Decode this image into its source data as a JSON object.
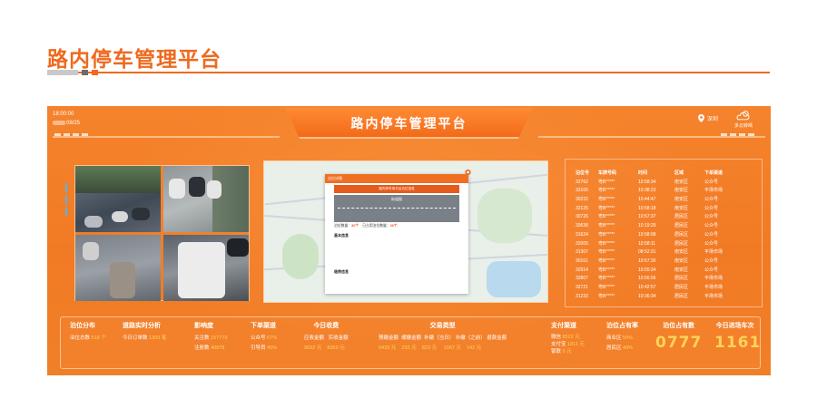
{
  "page": {
    "title": "路内停车管理平台"
  },
  "colors": {
    "accent": "#ef6a1e",
    "highlight": "#ffd35a",
    "panel": "#f5832c"
  },
  "board": {
    "title": "路内停车管理平台",
    "time": "18:00:00",
    "date_suffix": "08/25",
    "location": "深圳",
    "weather": "多云转晴",
    "location_icon": "map-pin-icon",
    "weather_icon": "cloud-sun-icon"
  },
  "map_popup": {
    "title": "泊位详情",
    "subtitle": "路内停车场平台泊位信息",
    "road_label": "街道图",
    "stats": [
      {
        "label": "泊位数量：",
        "value": "30个"
      },
      {
        "label": "已占用泊位数量：",
        "value": "30个"
      }
    ],
    "section_basic": "基本信息",
    "section_pay": "缴费信息",
    "pin_icon": "map-marker-icon"
  },
  "berth_table": {
    "headers": [
      "泊位号",
      "车牌号码",
      "时间",
      "区域",
      "下单渠道"
    ],
    "rows": [
      [
        "32762",
        "粤B*****",
        "10:58:34",
        "南安区",
        "公众号"
      ],
      [
        "33106",
        "粤B*****",
        "10:38:23",
        "南安区",
        "平场市场"
      ],
      [
        "30232",
        "粤B*****",
        "10:44:47",
        "南安区",
        "公众号"
      ],
      [
        "32125",
        "粤B*****",
        "10:58:18",
        "南安区",
        "公众号"
      ],
      [
        "30726",
        "粤B*****",
        "10:57:37",
        "居民区",
        "公众号"
      ],
      [
        "33638",
        "粤B*****",
        "10:19:29",
        "居民区",
        "公众号"
      ],
      [
        "31624",
        "粤B*****",
        "10:58:08",
        "居民区",
        "公众号"
      ],
      [
        "32005",
        "粤B*****",
        "10:58:11",
        "居民区",
        "公众号"
      ],
      [
        "31307",
        "粤B*****",
        "08:52:31",
        "南安区",
        "平场市场"
      ],
      [
        "30101",
        "粤B*****",
        "10:57:30",
        "南安区",
        "公众号"
      ],
      [
        "32914",
        "粤B*****",
        "10:55:34",
        "南安区",
        "公众号"
      ],
      [
        "32807",
        "粤B*****",
        "10:56:56",
        "居民区",
        "平场市场"
      ],
      [
        "32721",
        "粤B*****",
        "10:42:57",
        "居民区",
        "平场市场"
      ],
      [
        "31233",
        "粤B*****",
        "10:36:34",
        "居民区",
        "平场市场"
      ]
    ]
  },
  "stats": {
    "berth_dist": {
      "title": "泊位分布",
      "label": "泊位总数",
      "value": "518 个"
    },
    "road_analysis": {
      "title": "道路实时分析",
      "label": "今日订单数",
      "value": "1309 笔"
    },
    "influence": {
      "title": "影响度",
      "row1_label": "关注数",
      "row1_value": "157779",
      "row2_label": "注册数",
      "row2_value": "40878"
    },
    "order_channel": {
      "title": "下单渠道",
      "row1_label": "公众号",
      "row1_value": "67%",
      "row2_label": "引导员",
      "row2_value": "45%"
    },
    "today_income": {
      "title": "今日收费",
      "col1": "应收金额",
      "col2": "实收金额",
      "val1": "9032 元",
      "val2": "8369 元"
    },
    "trade_type": {
      "title": "交易类型",
      "cols": [
        "预缴金额",
        "缓缴金额",
        "补缴（当日）",
        "补缴（之前）",
        "退款金额"
      ],
      "vals": [
        "6429 元",
        "232 元",
        "823 元",
        "1067 元",
        "142 元"
      ]
    },
    "pay_channel": {
      "title": "支付渠道",
      "rows": [
        {
          "label": "微信",
          "value": "8522 元"
        },
        {
          "label": "支付宝",
          "value": "1811 元"
        },
        {
          "label": "银联",
          "value": "0 元"
        }
      ]
    },
    "occupancy_rate": {
      "title": "泊位占有率",
      "rows": [
        {
          "label": "商业区",
          "value": "50%"
        },
        {
          "label": "居民区",
          "value": "49%"
        }
      ]
    },
    "occupied": {
      "title": "泊位占有数",
      "value": "0777"
    },
    "entries": {
      "title": "今日进场车次",
      "value": "1161"
    }
  }
}
